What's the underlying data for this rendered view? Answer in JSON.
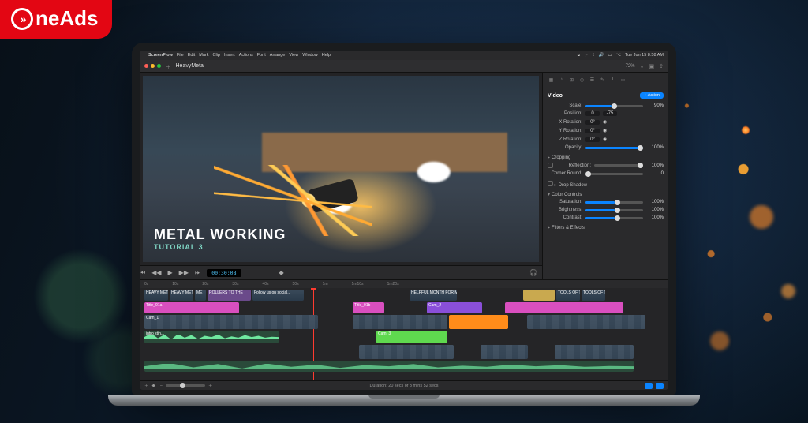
{
  "brand": {
    "name": "neAds"
  },
  "mac_menu": {
    "apple": "",
    "app": "ScreenFlow",
    "items": [
      "File",
      "Edit",
      "Mark",
      "Clip",
      "Insert",
      "Actions",
      "Font",
      "Arrange",
      "View",
      "Window",
      "Help"
    ],
    "right_time": "Tue Jun 15  8:58 AM"
  },
  "toolbar": {
    "project": "HeavyMetal",
    "zoom_pct": "72%"
  },
  "canvas": {
    "title_line1": "METAL WORKING",
    "title_line2": "TUTORIAL 3"
  },
  "transport": {
    "timecode": "00:30:08"
  },
  "inspector": {
    "header": "Video",
    "action_label": "+ Action",
    "props": {
      "scale": {
        "label": "Scale:",
        "value": "90%"
      },
      "position": {
        "label": "Position:",
        "x": "0",
        "y": "-75"
      },
      "xrot": {
        "label": "X Rotation:",
        "value": "0°"
      },
      "yrot": {
        "label": "Y Rotation:",
        "value": "0°"
      },
      "zrot": {
        "label": "Z Rotation:",
        "value": "0°"
      },
      "opacity": {
        "label": "Opacity:",
        "value": "100%"
      }
    },
    "sections": {
      "cropping": "Cropping",
      "reflection": {
        "label": "Reflection:",
        "value": "100%"
      },
      "corner": {
        "label": "Corner Round:",
        "value": "0"
      },
      "dropshadow": "Drop Shadow",
      "colorcontrols": "Color Controls",
      "saturation": {
        "label": "Saturation:",
        "value": "100%"
      },
      "brightness": {
        "label": "Brightness:",
        "value": "100%"
      },
      "contrast": {
        "label": "Contrast:",
        "value": "100%"
      },
      "filters": "Filters & Effects"
    }
  },
  "timeline": {
    "ruler": [
      "0s",
      "10s",
      "20s",
      "30s",
      "40s",
      "50s",
      "1m",
      "1m10s",
      "1m20s"
    ],
    "duration_label": "Duration: 20 secs of 3 mins 52 secs",
    "clip_labels": {
      "heavy": "HEAVY METAL",
      "rollers": "ROLLERS TO THE",
      "follow": "Follow us on social...",
      "helpful": "HELPFUL MONTH FOR MONT...",
      "tools": "TOOLS OF THE",
      "cam1": "Cam_1",
      "cam2": "Cam_2",
      "cam3": "Cam_3",
      "title1": "Title_01a",
      "title1b": "Title_01b",
      "intro": "intro stin..."
    }
  }
}
